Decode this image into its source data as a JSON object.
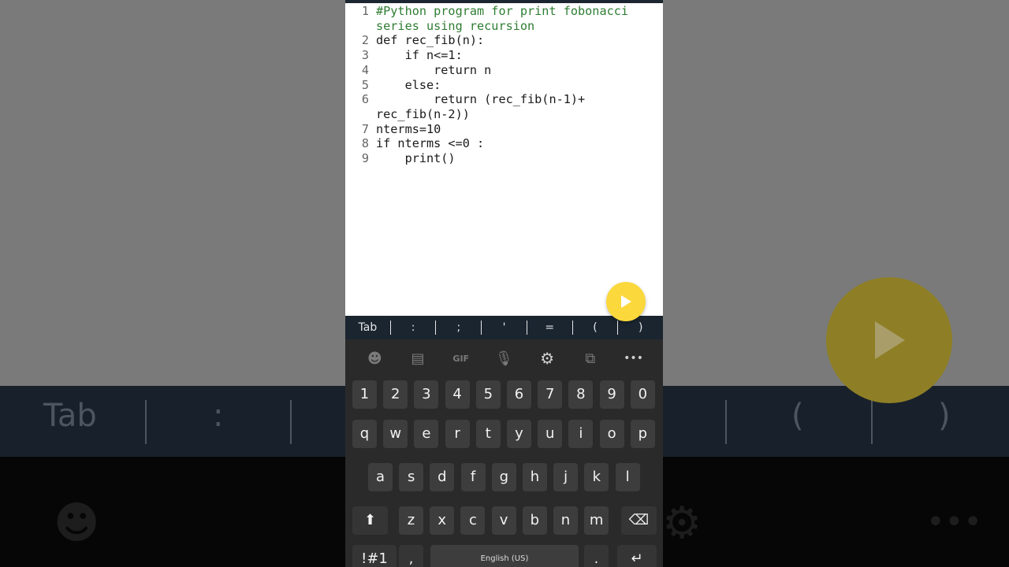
{
  "editor": {
    "lines": [
      {
        "n": "1",
        "text": "#Python program for print fobonacci",
        "kind": "comment"
      },
      {
        "n": "",
        "text": "series using recursion",
        "kind": "comment"
      },
      {
        "n": "2",
        "text": "def rec_fib(n):",
        "kind": "code"
      },
      {
        "n": "3",
        "text": "    if n<=1:",
        "kind": "code"
      },
      {
        "n": "4",
        "text": "        return n",
        "kind": "code"
      },
      {
        "n": "5",
        "text": "    else:",
        "kind": "code"
      },
      {
        "n": "6",
        "text": "        return (rec_fib(n-1)+",
        "kind": "code"
      },
      {
        "n": "",
        "text": "rec_fib(n-2))",
        "kind": "code"
      },
      {
        "n": "7",
        "text": "nterms=10",
        "kind": "code"
      },
      {
        "n": "8",
        "text": "if nterms <=0 :",
        "kind": "code"
      },
      {
        "n": "9",
        "text": "    print()",
        "kind": "code"
      }
    ]
  },
  "symbols": [
    "Tab",
    ":",
    ";",
    "'",
    "=",
    "(",
    ")"
  ],
  "toolbar_icons": [
    "emoji-icon",
    "sticker-icon",
    "gif-icon",
    "mic-icon",
    "settings-icon",
    "translate-icon",
    "more-icon"
  ],
  "keys": {
    "row_numbers": [
      "1",
      "2",
      "3",
      "4",
      "5",
      "6",
      "7",
      "8",
      "9",
      "0"
    ],
    "row_1": [
      "q",
      "w",
      "e",
      "r",
      "t",
      "y",
      "u",
      "i",
      "o",
      "p"
    ],
    "row_2": [
      "a",
      "s",
      "d",
      "f",
      "g",
      "h",
      "j",
      "k",
      "l"
    ],
    "row_3": [
      "z",
      "x",
      "c",
      "v",
      "b",
      "n",
      "m"
    ],
    "symbols_key": "!#1",
    "comma_key": ",",
    "space_label": "English (US)",
    "period_key": "."
  },
  "colors": {
    "run_button": "#fbd83b",
    "symbol_bar": "#1a2530",
    "keyboard": "#2a2a2a",
    "comment": "#2e7d32"
  }
}
